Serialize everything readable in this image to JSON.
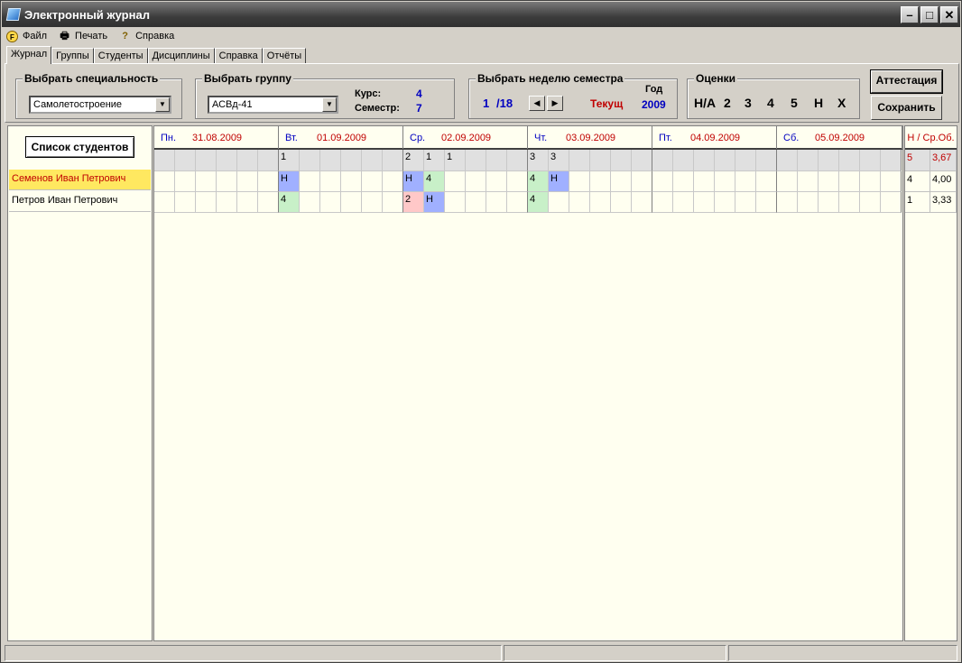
{
  "window": {
    "title": "Электронный журнал",
    "minimize": "–",
    "maximize": "□",
    "close": "✕"
  },
  "menu": [
    {
      "label": "Файл",
      "icon": "file-icon",
      "glyph": "F"
    },
    {
      "label": "Печать",
      "icon": "printer-icon",
      "glyph": "🖶"
    },
    {
      "label": "Справка",
      "icon": "help-icon",
      "glyph": "?"
    }
  ],
  "tabs": [
    "Журнал",
    "Группы",
    "Студенты",
    "Дисциплины",
    "Справка",
    "Отчёты"
  ],
  "controls": {
    "specialty_title": "Выбрать специальность",
    "specialty_value": "Самолетостроение",
    "group_title": "Выбрать группу",
    "group_value": "АСВд-41",
    "course_label": "Курс:",
    "course_value": "4",
    "semester_label": "Семестр:",
    "semester_value": "7",
    "week_title": "Выбрать неделю семестра",
    "week_current": "1",
    "week_total": "/18",
    "week_now": "Текущ",
    "year_label": "Год",
    "year_value": "2009",
    "grades_title": "Оценки",
    "grades": [
      "Н/А",
      "2",
      "3",
      "4",
      "5",
      "Н",
      "X"
    ],
    "attest_button": "Аттестация",
    "save_button": "Сохранить"
  },
  "students_button": "Список студентов",
  "students": [
    {
      "name": "Семенов Иван Петрович",
      "selected": true
    },
    {
      "name": "Петров Иван Петрович",
      "selected": false
    }
  ],
  "days": [
    {
      "name": "Пн.",
      "date": "31.08.2009"
    },
    {
      "name": "Вт.",
      "date": "01.09.2009"
    },
    {
      "name": "Ср.",
      "date": "02.09.2009"
    },
    {
      "name": "Чт.",
      "date": "03.09.2009"
    },
    {
      "name": "Пт.",
      "date": "04.09.2009"
    },
    {
      "name": "Сб.",
      "date": "05.09.2009"
    }
  ],
  "header_row": [
    "",
    "",
    "",
    "",
    "",
    "",
    "1",
    "",
    "",
    "",
    "",
    "",
    "2",
    "1",
    "1",
    "",
    "",
    "",
    "3",
    "3",
    "",
    "",
    "",
    "",
    "",
    "",
    "",
    "",
    "",
    "",
    "",
    "",
    "",
    "",
    "",
    ""
  ],
  "grade_rows": [
    [
      "",
      "",
      "",
      "",
      "",
      "",
      "Н",
      "",
      "",
      "",
      "",
      "",
      "Н",
      "4",
      "",
      "",
      "",
      "",
      "4",
      "Н",
      "",
      "",
      "",
      "",
      "",
      "",
      "",
      "",
      "",
      "",
      "",
      "",
      "",
      "",
      "",
      ""
    ],
    [
      "",
      "",
      "",
      "",
      "",
      "",
      "4",
      "",
      "",
      "",
      "",
      "",
      "2",
      "Н",
      "",
      "",
      "",
      "",
      "4",
      "",
      "",
      "",
      "",
      "",
      "",
      "",
      "",
      "",
      "",
      "",
      "",
      "",
      "",
      "",
      "",
      ""
    ]
  ],
  "summary": {
    "header": "Н / Ср.Об.",
    "total": [
      "5",
      "3,67"
    ],
    "rows": [
      [
        "4",
        "4,00"
      ],
      [
        "1",
        "3,33"
      ]
    ]
  },
  "colors": {
    "accent_red": "#c00000",
    "accent_blue": "#0000c0",
    "absent_blue": "#a0b0ff",
    "grade_green": "#c8f0c8",
    "grade_red": "#ffc8c8",
    "selected_yellow": "#ffe860"
  }
}
